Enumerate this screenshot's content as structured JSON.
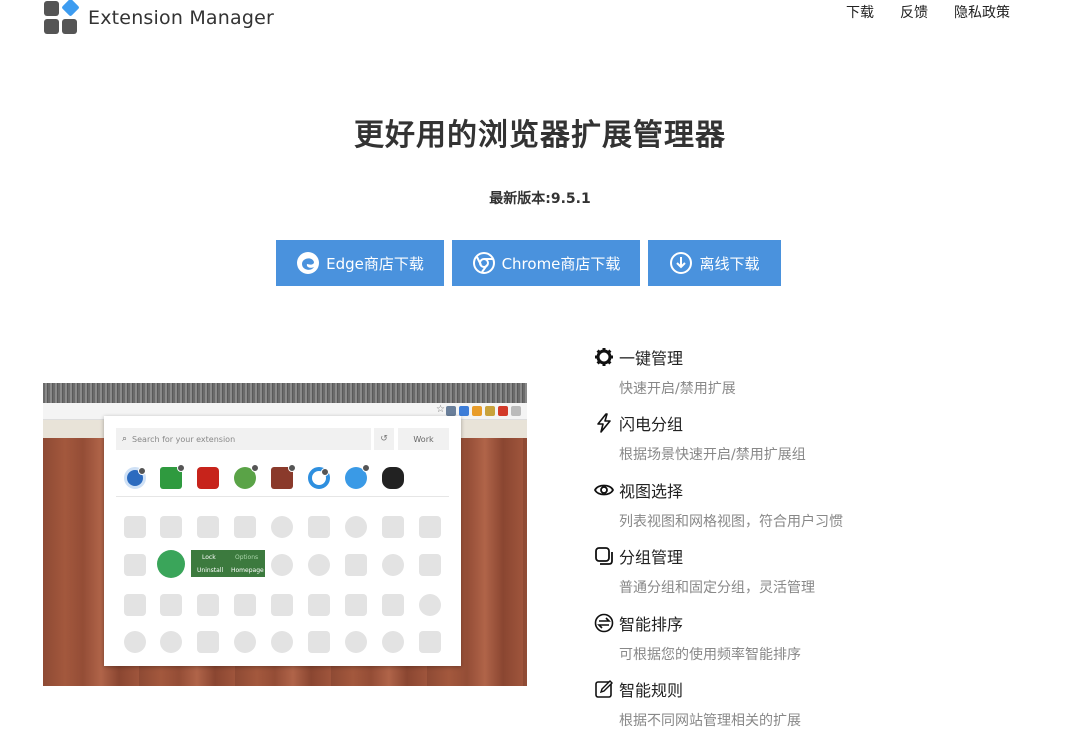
{
  "header": {
    "brand_name": "Extension Manager",
    "nav": [
      "下载",
      "反馈",
      "隐私政策"
    ]
  },
  "hero": {
    "title": "更好用的浏览器扩展管理器",
    "version": "最新版本:9.5.1"
  },
  "downloads": [
    {
      "label": "Edge商店下载",
      "icon": "edge-icon"
    },
    {
      "label": "Chrome商店下载",
      "icon": "chrome-icon"
    },
    {
      "label": "离线下载",
      "icon": "download-icon"
    }
  ],
  "screenshot": {
    "search_placeholder": "Search for your extension",
    "group_label": "Work",
    "context_menu": {
      "lock": "Lock",
      "options": "Options",
      "uninstall": "Uninstall",
      "homepage": "Homepage"
    }
  },
  "features": [
    {
      "icon": "gear-icon",
      "title": "一键管理",
      "desc": "快速开启/禁用扩展"
    },
    {
      "icon": "lightning-icon",
      "title": "闪电分组",
      "desc": "根据场景快速开启/禁用扩展组"
    },
    {
      "icon": "eye-icon",
      "title": "视图选择",
      "desc": "列表视图和网格视图，符合用户习惯"
    },
    {
      "icon": "group-icon",
      "title": "分组管理",
      "desc": "普通分组和固定分组，灵活管理"
    },
    {
      "icon": "sort-icon",
      "title": "智能排序",
      "desc": "可根据您的使用频率智能排序"
    },
    {
      "icon": "rule-icon",
      "title": "智能规则",
      "desc": "根据不同网站管理相关的扩展"
    }
  ],
  "colors": {
    "accent": "#4a92dd",
    "logo_blue": "#3d9cf0",
    "menu_green": "#3c7a3e"
  }
}
